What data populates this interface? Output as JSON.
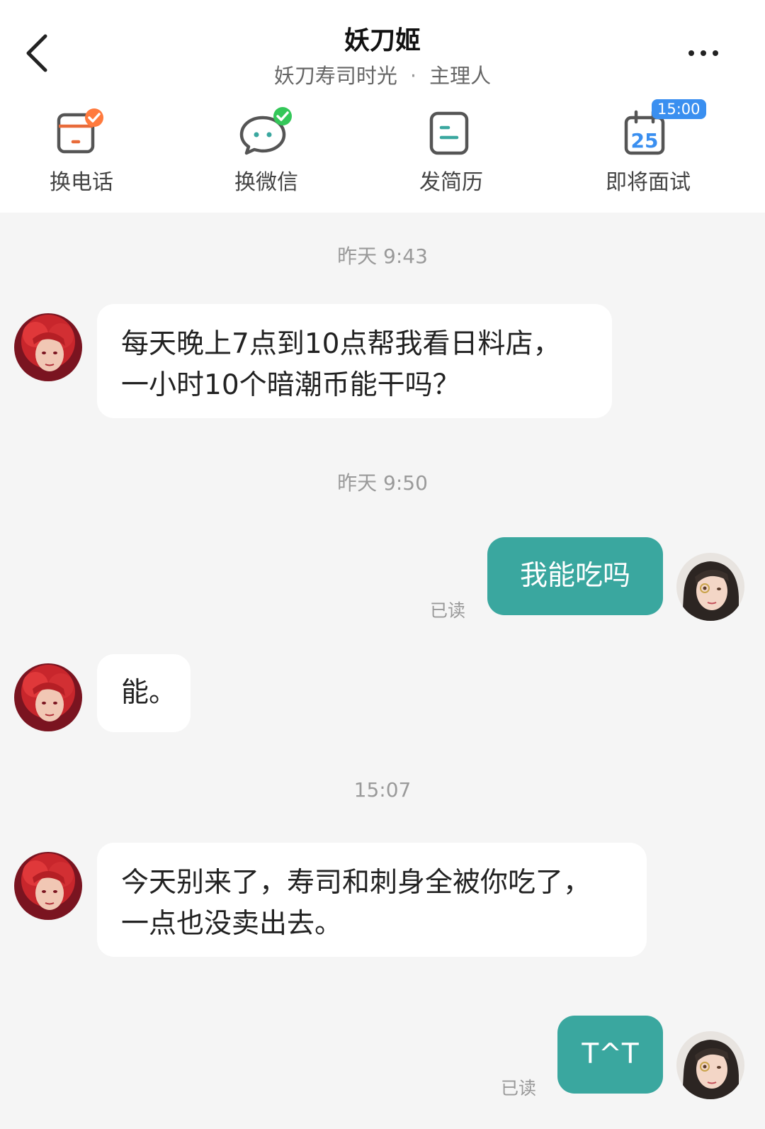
{
  "header": {
    "title": "妖刀姬",
    "company": "妖刀寿司时光",
    "separator": "·",
    "role": "主理人"
  },
  "actions": [
    {
      "label": "换电话",
      "icon": "phone-card-icon"
    },
    {
      "label": "换微信",
      "icon": "wechat-bubble-icon"
    },
    {
      "label": "发简历",
      "icon": "resume-icon"
    },
    {
      "label": "即将面试",
      "icon": "calendar-icon",
      "calendar_day": "25",
      "badge": "15:00"
    }
  ],
  "colors": {
    "accent": "#3aa79f",
    "badge_blue": "#3a8ff0",
    "check_green": "#34c759",
    "check_orange": "#ff7a3d"
  },
  "messages": [
    {
      "type": "timestamp",
      "text": "昨天  9:43"
    },
    {
      "type": "incoming",
      "lines": [
        "每天晚上7点到10点帮我看日料店，",
        "一小时10个暗潮币能干吗？"
      ]
    },
    {
      "type": "timestamp",
      "text": "昨天 9:50"
    },
    {
      "type": "outgoing",
      "text": "我能吃吗",
      "status": "已读"
    },
    {
      "type": "incoming",
      "lines": [
        "能。"
      ]
    },
    {
      "type": "timestamp",
      "text": "15:07"
    },
    {
      "type": "incoming",
      "lines": [
        "今天别来了，寿司和刺身全被你吃了，",
        "一点也没卖出去。"
      ]
    },
    {
      "type": "outgoing",
      "text": "T^T",
      "status": "已读"
    }
  ]
}
